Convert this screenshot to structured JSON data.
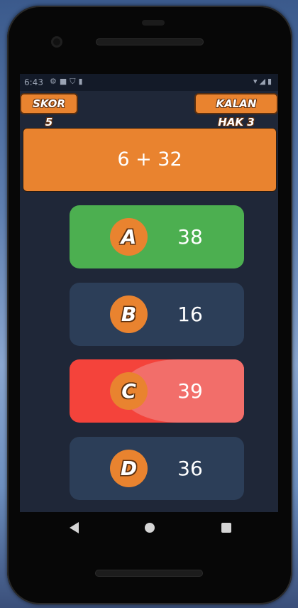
{
  "status": {
    "time": "6:43",
    "icons": [
      "gear-icon",
      "square-icon",
      "shield-icon",
      "sd-card-icon"
    ],
    "right_icons": [
      "wifi-icon",
      "signal-icon",
      "battery-icon"
    ]
  },
  "hud": {
    "score_label": "SKOR 5",
    "lives_label": "KALAN HAK 3"
  },
  "question": {
    "text": "6 + 32"
  },
  "answers": [
    {
      "letter": "A",
      "value": "38",
      "state": "correct",
      "color": "#4caf50"
    },
    {
      "letter": "B",
      "value": "16",
      "state": "neutral",
      "color": "#2c3e58"
    },
    {
      "letter": "C",
      "value": "39",
      "state": "wrong",
      "color": "#f4433b"
    },
    {
      "letter": "D",
      "value": "36",
      "state": "neutral",
      "color": "#2c3e58"
    }
  ],
  "colors": {
    "accent": "#e9832f",
    "background": "#1f2738"
  }
}
